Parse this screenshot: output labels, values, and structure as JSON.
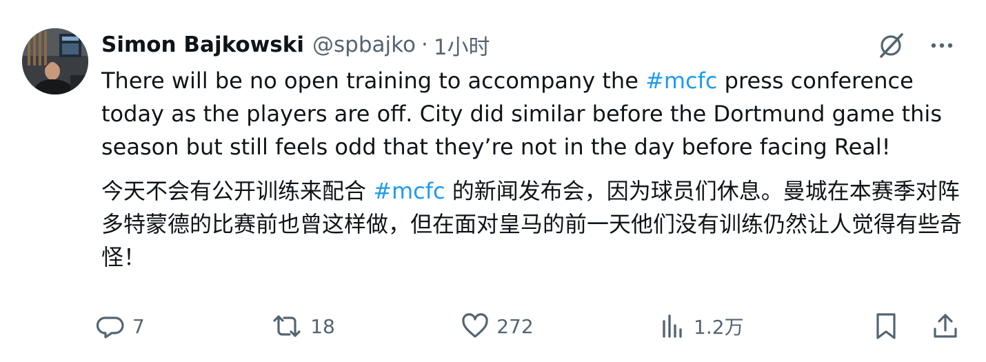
{
  "author": {
    "display_name": "Simon Bajkowski",
    "handle": "@spbajko",
    "separator": "·",
    "time": "1小时"
  },
  "tweet": {
    "original_before": "There will be no open training to accompany the ",
    "original_hashtag": "#mcfc",
    "original_after": " press conference today as the players are off. City did similar before the Dortmund game this season but still feels odd that they’re not in the day before facing Real!",
    "translated_before": "今天不会有公开训练来配合 ",
    "translated_hashtag": "#mcfc",
    "translated_after": " 的新闻发布会，因为球员们休息。曼城在本赛季对阵多特蒙德的比赛前也曾这样做，但在面对皇马的前一天他们没有训练仍然让人觉得有些奇怪！"
  },
  "stats": {
    "replies": "7",
    "reposts": "18",
    "likes": "272",
    "views": "1.2万"
  },
  "icons": {
    "grok": "grok-icon",
    "more": "more-icon",
    "reply": "reply-icon",
    "repost": "repost-icon",
    "like": "like-icon",
    "views": "views-icon",
    "bookmark": "bookmark-icon",
    "share": "share-icon"
  },
  "colors": {
    "text": "#0f1419",
    "secondary": "#536471",
    "link": "#1d9bf0"
  }
}
